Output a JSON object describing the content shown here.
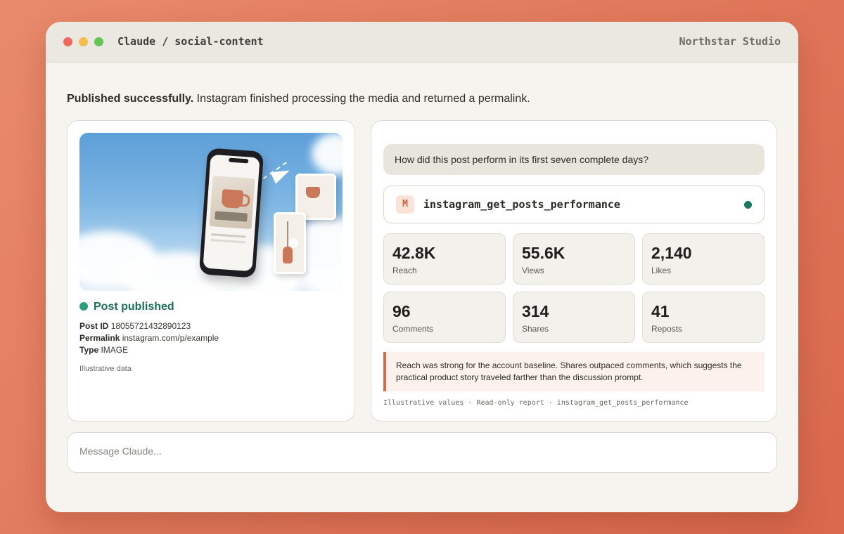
{
  "window": {
    "title": "Claude / social-content",
    "org": "Northstar Studio"
  },
  "status": {
    "bold": "Published successfully.",
    "rest": " Instagram finished processing the media and returned a permalink."
  },
  "post": {
    "status_label": "Post published",
    "fields": [
      {
        "key": "Post ID",
        "value": "18055721432890123"
      },
      {
        "key": "Permalink",
        "value": "instagram.com/p/example"
      },
      {
        "key": "Type",
        "value": "IMAGE"
      }
    ],
    "note": "Illustrative data"
  },
  "chat": {
    "question": "How did this post perform in its first seven complete days?",
    "tool": {
      "badge": "M",
      "name": "instagram_get_posts_performance"
    },
    "metrics": [
      {
        "value": "42.8K",
        "label": "Reach"
      },
      {
        "value": "55.6K",
        "label": "Views"
      },
      {
        "value": "2,140",
        "label": "Likes"
      },
      {
        "value": "96",
        "label": "Comments"
      },
      {
        "value": "314",
        "label": "Shares"
      },
      {
        "value": "41",
        "label": "Reposts"
      }
    ],
    "insight": "Reach was strong for the account baseline. Shares outpaced comments, which suggests the practical product story traveled farther than the discussion prompt.",
    "footnote": "Illustrative values · Read-only report · instagram_get_posts_performance"
  },
  "composer": {
    "placeholder": "Message Claude..."
  },
  "colors": {
    "accent": "#d36f4f",
    "success": "#2f9e7d",
    "tool_dot": "#1c7a62"
  }
}
